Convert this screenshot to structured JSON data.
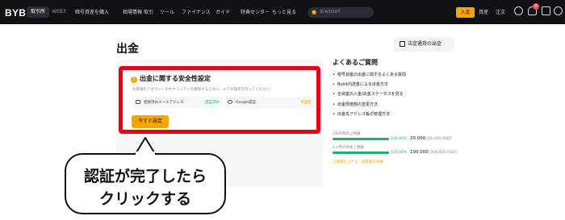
{
  "header": {
    "logo": "BYBIT",
    "mode_tabs": [
      "取引所",
      "WEB3"
    ],
    "nav": [
      "暗号資産を購入",
      "相場情報",
      "取引",
      "ツール",
      "ファイナンス",
      "ガイド",
      "特典センター",
      "もっと見る"
    ],
    "search_placeholder": "SCA/USDT",
    "deposit_label": "入金",
    "assets_label": "資産",
    "orders_label": "注文",
    "notification_count": "0"
  },
  "page": {
    "title": "出金",
    "fiat_button": "法定通貨の出金"
  },
  "security": {
    "title": "出金に関する安全性設定",
    "description": "お客様のアカウントのセキュリティを確保するために、以下の操作を行ってください。",
    "requirements": [
      {
        "label": "登録済みメールアドレス",
        "status": "認証済み",
        "icon": "mail-icon"
      },
      {
        "label": "Google認証",
        "status": "未設定",
        "icon": "google-icon"
      }
    ],
    "setup_button": "今すぐ設定"
  },
  "faq": {
    "title": "よくあるご質問",
    "items": [
      "暗号資産の出金に関するよくある質問",
      "Bybit内送金による出金方法",
      "全資産の入金/出金ステータスを見る",
      "出金限度額の変更方法",
      "出金先アドレス帳の管理方法"
    ]
  },
  "limits": {
    "rows": [
      {
        "label": "1日の残高上限額",
        "percent": "100.00%",
        "amount": "20,000",
        "cap": "/20,000 USDT",
        "fill": 1.0
      },
      {
        "label": "1ヶ月の残高上限額",
        "percent": "100.00%",
        "amount": "100,000",
        "cap": "/100,000 USDT",
        "fill": 1.0
      }
    ],
    "links": "上限額を上げる　限度額の詳細"
  },
  "callout": {
    "line1": "認証が完了したら",
    "line2": "クリックする"
  },
  "colors": {
    "accent": "#f7a600",
    "highlight": "#e8001b",
    "success": "#20b26c",
    "nav_bg": "#101114"
  }
}
